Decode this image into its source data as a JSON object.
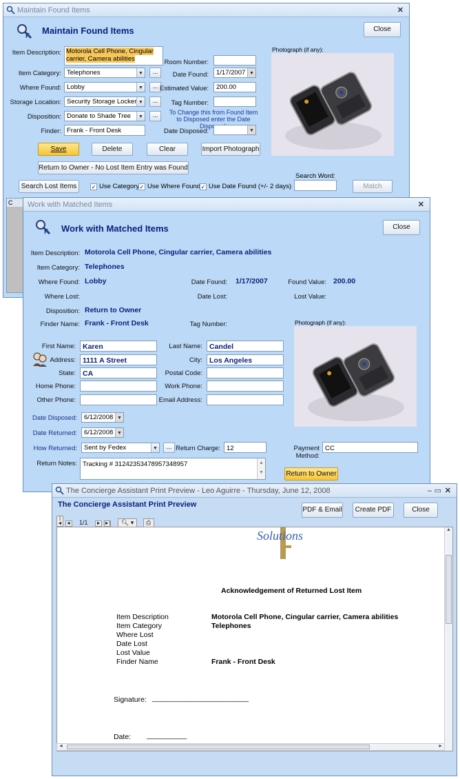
{
  "win1": {
    "title": "Maintain Found Items",
    "heading": "Maintain Found Items",
    "close": "Close",
    "labels": {
      "item_description": "Item Description:",
      "item_category": "Item Category:",
      "where_found": "Where Found:",
      "storage_location": "Storage Location:",
      "disposition": "Disposition:",
      "finder": "Finder:",
      "room_number": "Room Number:",
      "date_found": "Date Found:",
      "estimated_value": "Estimated Value:",
      "tag_number": "Tag Number:",
      "date_disposed": "Date Disposed:",
      "photograph": "Photograph (if any):",
      "search_word": "Search Word:"
    },
    "values": {
      "item_description": "Motorola Cell Phone, Cingular carrier, Camera abilities",
      "item_category": "Telephones",
      "where_found": "Lobby",
      "storage_location": "Security Storage Locker",
      "disposition": "Donate to Shade Tree",
      "finder": "Frank - Front Desk",
      "room_number": "",
      "date_found": "1/17/2007",
      "estimated_value": "200.00",
      "tag_number": "",
      "date_disposed": "",
      "search_word": ""
    },
    "note": "To Change this from Found Item to Disposed enter the Date Disposed.",
    "buttons": {
      "save": "Save",
      "delete": "Delete",
      "clear": "Clear",
      "import_photo": "Import Photograph",
      "return_owner": "Return to Owner - No Lost Item Entry was Found",
      "search_lost": "Search Lost Items",
      "match": "Match"
    },
    "checks": {
      "use_category": "Use Category",
      "use_where": "Use Where Found",
      "use_date": "Use Date Found",
      "range": "(+/- 2 days)"
    },
    "list_stub": "C"
  },
  "win2": {
    "title": "Work with Matched Items",
    "heading": "Work with Matched Items",
    "close": "Close",
    "labels": {
      "item_description": "Item Description:",
      "item_category": "Item Category:",
      "where_found": "Where Found:",
      "where_lost": "Where Lost:",
      "disposition": "Disposition:",
      "finder_name": "Finder Name:",
      "date_found": "Date Found:",
      "date_lost": "Date Lost:",
      "tag_number": "Tag Number:",
      "found_value": "Found Value:",
      "lost_value": "Lost Value:",
      "photograph": "Photograph (if any):",
      "first_name": "First Name:",
      "address": "Address:",
      "state": "State:",
      "home_phone": "Home Phone:",
      "other_phone": "Other Phone:",
      "last_name": "Last Name:",
      "city": "City:",
      "postal_code": "Postal Code:",
      "work_phone": "Work Phone:",
      "email": "Email Address:",
      "date_disposed": "Date Disposed:",
      "date_returned": "Date Returned:",
      "how_returned": "How Returned:",
      "return_charge": "Return Charge:",
      "payment_method": "Payment Method:",
      "return_notes": "Return Notes:"
    },
    "values": {
      "item_description": "Motorola Cell Phone, Cingular carrier, Camera abilities",
      "item_category": "Telephones",
      "where_found": "Lobby",
      "disposition": "Return to Owner",
      "finder_name": "Frank - Front Desk",
      "date_found": "1/17/2007",
      "found_value": "200.00",
      "first_name": "Karen",
      "address": "1111 A Street",
      "state": "CA",
      "last_name": "Candel",
      "city": "Los Angeles",
      "date_disposed": "6/12/2008",
      "date_returned": "6/12/2008",
      "how_returned": "Sent by Fedex",
      "return_charge": "12",
      "payment_method": "CC",
      "return_notes": "Tracking # 31242353478957348957"
    },
    "return_button": "Return to Owner"
  },
  "win3": {
    "title": "The Concierge Assistant Print Preview - Leo Aguirre - Thursday, June 12, 2008",
    "heading": "The Concierge Assistant Print Preview",
    "buttons": {
      "pdf_email": "PDF & Email",
      "create_pdf": "Create PDF",
      "close": "Close"
    },
    "page_counter": "1/1",
    "logo_text": "Solutions",
    "doc": {
      "title": "Acknowledgement of Returned Lost Item",
      "rows": [
        {
          "label": "Item Description",
          "value": "Motorola Cell Phone, Cingular carrier, Camera abilities"
        },
        {
          "label": "Item Category",
          "value": "Telephones"
        },
        {
          "label": "Where Lost",
          "value": ""
        },
        {
          "label": "Date Lost",
          "value": ""
        },
        {
          "label": "Lost Value",
          "value": ""
        },
        {
          "label": "Finder Name",
          "value": "Frank - Front Desk"
        }
      ],
      "signature": "Signature:",
      "signature_line": "________________________",
      "date": "Date:",
      "date_line": "__________"
    }
  }
}
